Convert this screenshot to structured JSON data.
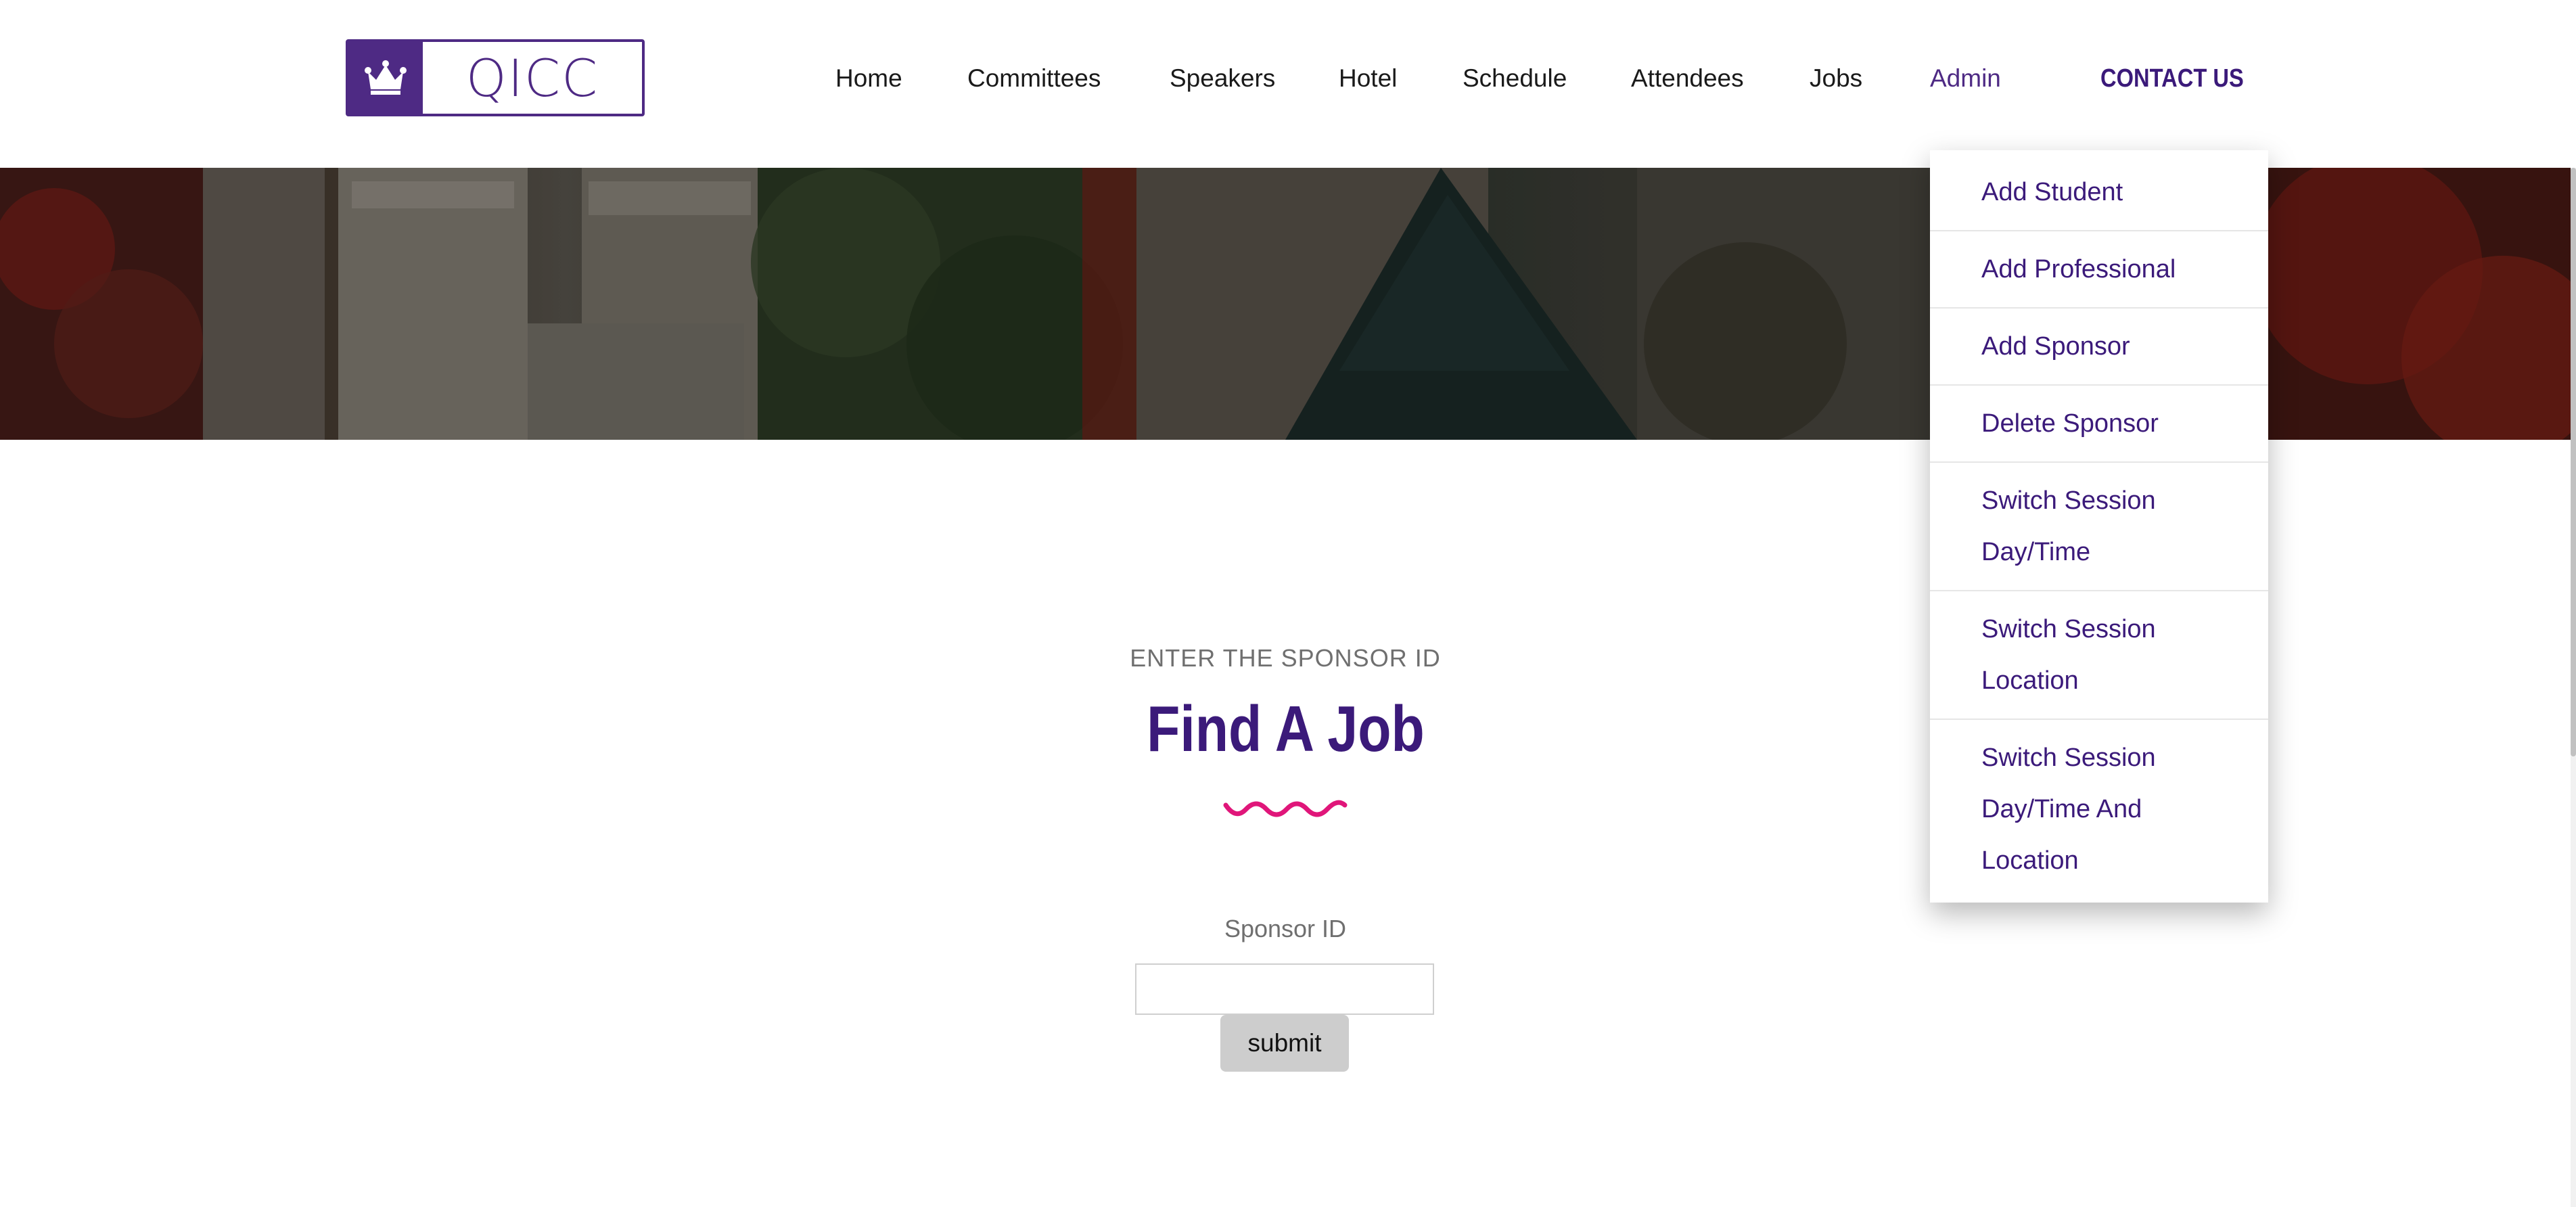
{
  "brand": {
    "logo_text": "QICC",
    "logo_color": "#4e2a84"
  },
  "nav": {
    "items": [
      {
        "label": "Home"
      },
      {
        "label": "Committees"
      },
      {
        "label": "Speakers"
      },
      {
        "label": "Hotel"
      },
      {
        "label": "Schedule"
      },
      {
        "label": "Attendees"
      },
      {
        "label": "Jobs"
      },
      {
        "label": "Admin",
        "active": true
      }
    ],
    "contact_label": "CONTACT US"
  },
  "admin_menu": {
    "items": [
      {
        "label": "Add Student"
      },
      {
        "label": "Add Professional"
      },
      {
        "label": "Add Sponsor"
      },
      {
        "label": "Delete Sponsor"
      },
      {
        "label": "Switch Session\nDay/Time"
      },
      {
        "label": "Switch Session\nLocation"
      },
      {
        "label": "Switch Session\nDay/Time And\nLocation"
      }
    ]
  },
  "main": {
    "eyebrow": "ENTER THE SPONSOR ID",
    "title": "Find A Job",
    "field_label": "Sponsor ID",
    "field_value": "",
    "submit_label": "submit"
  },
  "colors": {
    "primary": "#3b1a7a",
    "accent": "#e0167a",
    "muted_text": "#6f6f6f"
  },
  "icons": {
    "logo_mark": "crown-icon",
    "divider": "squiggle-divider-icon"
  }
}
